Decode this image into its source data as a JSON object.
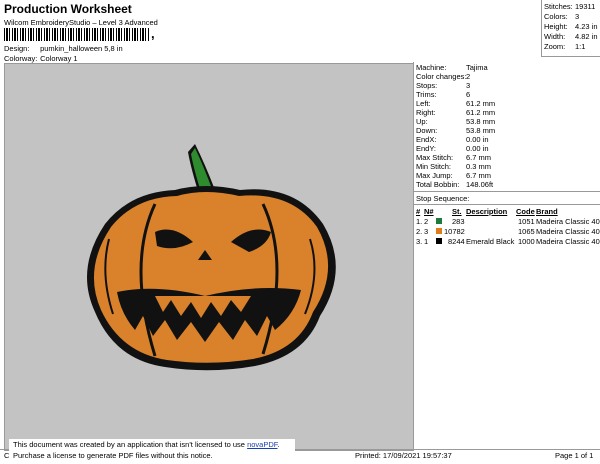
{
  "header": {
    "title": "Production Worksheet",
    "subtitle": "Wilcom EmbroideryStudio – Level 3 Advanced",
    "barcode_suffix": ",",
    "design_label": "Design:",
    "design_value": "pumkin_halloween 5,8 in",
    "colorway_label": "Colorway:",
    "colorway_value": "Colorway 1"
  },
  "summary": {
    "stitches_label": "Stitches:",
    "stitches_value": "19311",
    "colors_label": "Colors:",
    "colors_value": "3",
    "height_label": "Height:",
    "height_value": "4.23 in",
    "width_label": "Width:",
    "width_value": "4.82 in",
    "zoom_label": "Zoom:",
    "zoom_value": "1:1"
  },
  "machine": [
    {
      "label": "Machine:",
      "value": "Tajima"
    },
    {
      "label": "Color changes:",
      "value": "2"
    },
    {
      "label": "Stops:",
      "value": "3"
    },
    {
      "label": "Trims:",
      "value": "6"
    },
    {
      "label": "Left:",
      "value": "61.2 mm"
    },
    {
      "label": "Right:",
      "value": "61.2 mm"
    },
    {
      "label": "Up:",
      "value": "53.8 mm"
    },
    {
      "label": "Down:",
      "value": "53.8 mm"
    },
    {
      "label": "EndX:",
      "value": "0.00 in"
    },
    {
      "label": "EndY:",
      "value": "0.00 in"
    },
    {
      "label": "Max Stitch:",
      "value": "6.7 mm"
    },
    {
      "label": "Min Stitch:",
      "value": "0.3 mm"
    },
    {
      "label": "Max Jump:",
      "value": "6.7 mm"
    },
    {
      "label": "Total Bobbin:",
      "value": "148.06ft"
    }
  ],
  "stop_sequence": {
    "title": "Stop Sequence:",
    "headers": {
      "num": "#",
      "n": "N#",
      "st": "St.",
      "description": "Description",
      "code": "Code",
      "brand": "Brand"
    },
    "rows": [
      {
        "num": "1.",
        "n": "2",
        "color": "#1e7a3a",
        "st": "283",
        "description": "",
        "code": "1051",
        "brand": "Madeira Classic 40"
      },
      {
        "num": "2.",
        "n": "3",
        "color": "#e07b1a",
        "st": "10782",
        "description": "",
        "code": "1065",
        "brand": "Madeira Classic 40"
      },
      {
        "num": "3.",
        "n": "1",
        "color": "#000000",
        "st": "8244",
        "description": "Emerald Black",
        "code": "1000",
        "brand": "Madeira Classic 40"
      }
    ]
  },
  "footer": {
    "note_line1": "This document was created by an application that isn't licensed to use",
    "note_link": "novaPDF",
    "note_line1_end": ".",
    "note_line2": "Purchase a license to generate PDF files without this notice.",
    "cr": "Cr",
    "printed": "Printed: 17/09/2021 19:57:37",
    "page": "Page 1 of 1"
  }
}
